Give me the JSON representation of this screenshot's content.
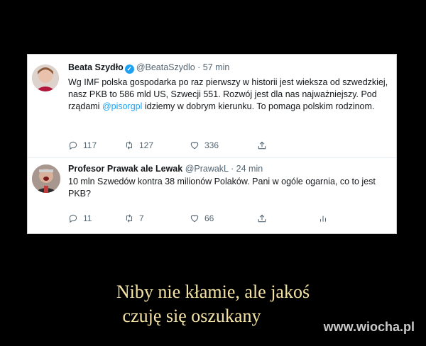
{
  "tweets": [
    {
      "name": "Beata Szydło",
      "handle": "@BeataSzydlo",
      "time": "· 57 min",
      "text_before": "Wg IMF polska gospodarka po raz pierwszy w historii jest wieksza od szwedzkiej, nasz PKB to 586 mld US, Szwecji 551. Rozwój jest dla nas najważniejszy. Pod rządami ",
      "mention": "@pisorgpl",
      "text_after": " idziemy w dobrym kierunku. To pomaga polskim rodzinom.",
      "replies": "117",
      "retweets": "127",
      "likes": "336"
    },
    {
      "name": "Profesor Prawak ale Lewak",
      "handle": "@PrawakL",
      "time": "· 24 min",
      "text": "10 mln Szwedów kontra 38 milionów Polaków. Pani w ogóle ogarnia, co to jest PKB?",
      "replies": "11",
      "retweets": "7",
      "likes": "66"
    }
  ],
  "caption": {
    "line1": "Niby nie kłamie, ale jakoś",
    "line2": "czuję się oszukany"
  },
  "watermark": "www.wiocha.pl",
  "colors": {
    "accent": "#1da1f2",
    "caption": "#f4e3a4"
  }
}
